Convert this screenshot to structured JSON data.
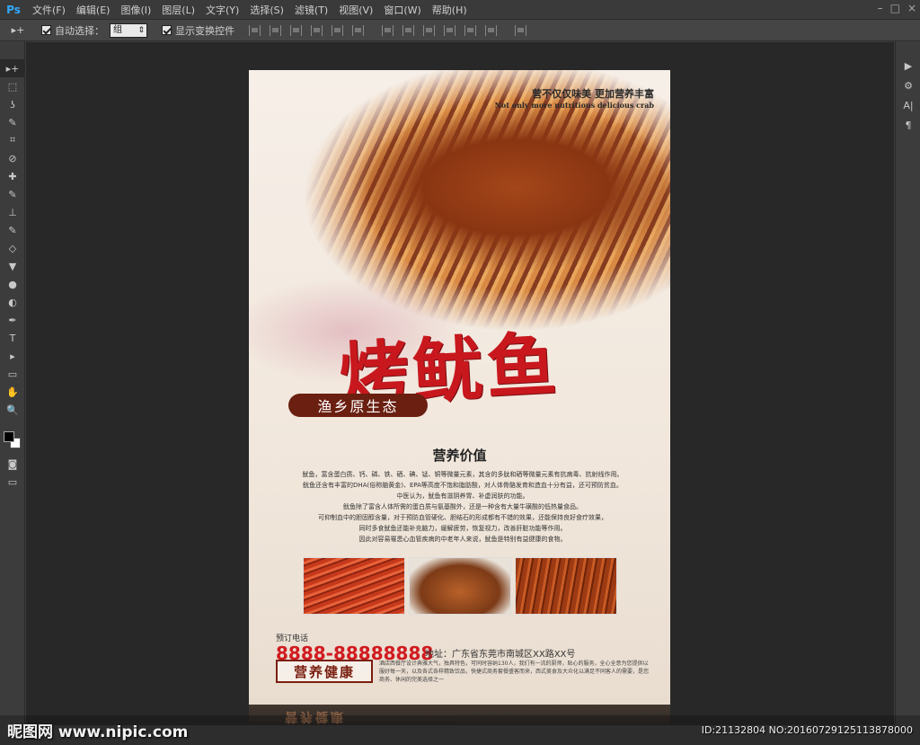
{
  "app": {
    "logo": "Ps"
  },
  "menu": [
    "文件(F)",
    "编辑(E)",
    "图像(I)",
    "图层(L)",
    "文字(Y)",
    "选择(S)",
    "滤镜(T)",
    "视图(V)",
    "窗口(W)",
    "帮助(H)"
  ],
  "window_controls": [
    "–",
    "□",
    "×"
  ],
  "options": {
    "tool_glyph": "▸+",
    "auto_select_label": "自动选择：",
    "auto_select_value": "组",
    "show_transform_label": "显示变换控件"
  },
  "tools": [
    "▸+",
    "⬚",
    "ʖ",
    "✎",
    "⌗",
    "⊘",
    "✚",
    "✎",
    "⊥",
    "✎",
    "◇",
    "▼",
    "●",
    "◐",
    "✒",
    "T",
    "▸",
    "▭",
    "✋",
    "🔍"
  ],
  "right_panel": [
    "▶",
    "⚙",
    "A|",
    "¶"
  ],
  "poster": {
    "slogan_cn": "营不仅仅味美 更加营养丰富",
    "slogan_en": "Not only more nutritious delicious crab",
    "title": "烤鱿鱼",
    "badge": "渔乡原生态",
    "section_title": "营养价值",
    "body_lines": [
      "鱿鱼，富含蛋白质、钙、磷、铁、硒、碘、锰、铜等微量元素，其含的多肽和硒等微量元素有抗病毒、抗射线作用。",
      "鱿鱼还含有丰富的DHA(俗称脑黄金)、EPA等高度不饱和脂肪酸，对人体骨骼发育和造血十分有益，还可预防贫血。",
      "中医认为，鱿鱼有滋阴养胃、补虚润肤的功能。",
      "鱿鱼除了富含人体所需的蛋白质与氨基酸外，还是一种含有大量牛磺酸的低热量食品。",
      "可抑制血中的胆固醇含量，对于预防血管硬化、胆结石的形成都有不错的效果，还能保持良好食疗效果，",
      "同时多食鱿鱼还能补充脑力，缓解疲劳，恢复视力，改善肝脏功能等作用。",
      "因此对容易罹患心血管疾病的中老年人来说，鱿鱼是特别有益健康的食物。"
    ],
    "order_label": "预订电话",
    "phone": "8888-88888888",
    "address": "地址：广东省东莞市南城区XX路XX号",
    "health": "营养健康",
    "fine_print": "酒店西餐厅设计典雅大气，独具特色，可同时容纳130人，我们有一流的厨师，贴心的服务，全心全意为您提供以服好每一天，以及各式各样精致饮品，快捷式商务套餐盛客而来，西式美食及大众化以满足不同客人的需要，是您商务、休闲的完美选择之一",
    "reflection_text": "营养健康"
  },
  "watermark": {
    "left": "昵图网 www.nipic.com",
    "right": "ID:21132804 NO:20160729125113878000"
  }
}
